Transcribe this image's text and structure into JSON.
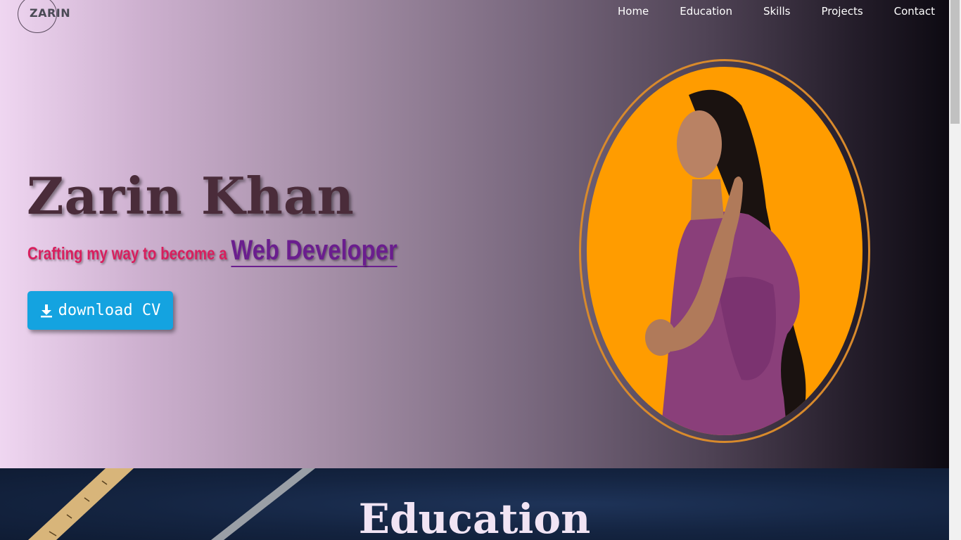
{
  "logo": {
    "text": "ZARIN"
  },
  "nav": {
    "items": [
      "Home",
      "Education",
      "Skills",
      "Projects",
      "Contact"
    ]
  },
  "hero": {
    "name": "Zarin Khan",
    "tagline_prefix": "Crafting my way to become a ",
    "tagline_role": "Web Developer",
    "cta_label": "download CV",
    "cta_icon": "download-icon",
    "photo_bg_color": "#ff9c00"
  },
  "education": {
    "title": "Education"
  },
  "colors": {
    "accent": "#14a3e0",
    "name": "#4a2c3a",
    "tagline": "#d81f5e",
    "role": "#6a1e8e"
  }
}
